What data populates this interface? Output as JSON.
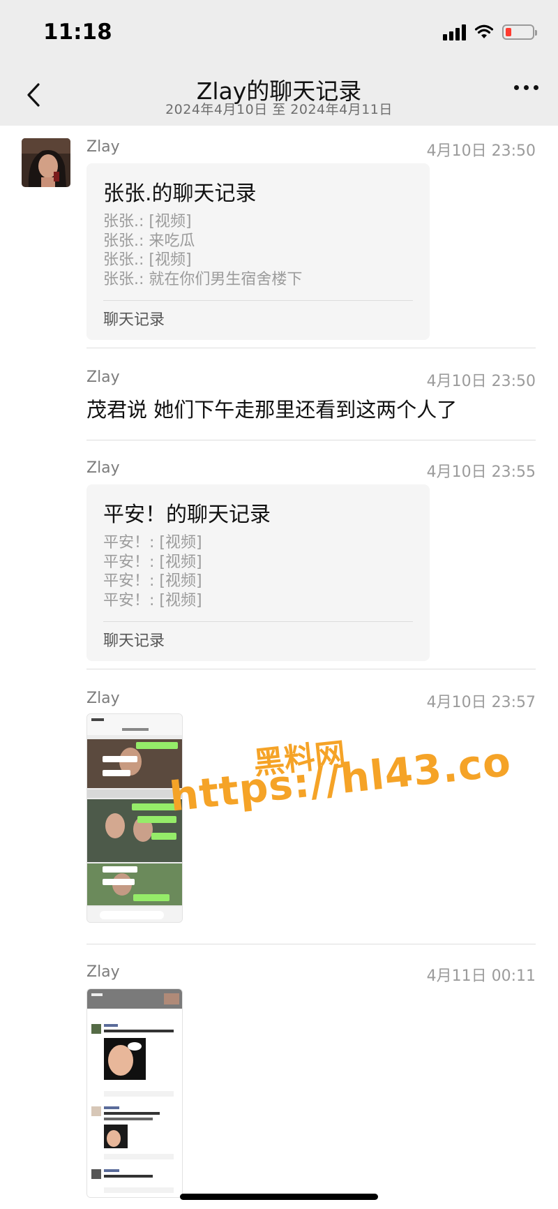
{
  "status_bar": {
    "time": "11:18"
  },
  "nav": {
    "title": "Zlay的聊天记录",
    "subtitle": "2024年4月10日 至 2024年4月11日"
  },
  "messages": [
    {
      "sender": "Zlay",
      "time": "4月10日 23:50",
      "card": {
        "title": "张张.的聊天记录",
        "lines": [
          "张张.: [视频]",
          "张张.: 来吃瓜",
          "张张.: [视频]",
          "张张.: 就在你们男生宿舍楼下"
        ],
        "footer": "聊天记录"
      }
    },
    {
      "sender": "Zlay",
      "time": "4月10日 23:50",
      "text": "茂君说 她们下午走那里还看到这两个人了"
    },
    {
      "sender": "Zlay",
      "time": "4月10日 23:55",
      "card": {
        "title": "平安！的聊天记录",
        "lines": [
          "平安！: [视频]",
          "平安！: [视频]",
          "平安！: [视频]",
          "平安！: [视频]"
        ],
        "footer": "聊天记录"
      }
    },
    {
      "sender": "Zlay",
      "time": "4月10日 23:57",
      "image": "chat-screenshot"
    },
    {
      "sender": "Zlay",
      "time": "4月11日 00:11",
      "image": "moments-screenshot"
    }
  ],
  "watermark": {
    "line1": "黑料网",
    "line2": "https://hl43.co",
    "color": "#f5a327"
  }
}
